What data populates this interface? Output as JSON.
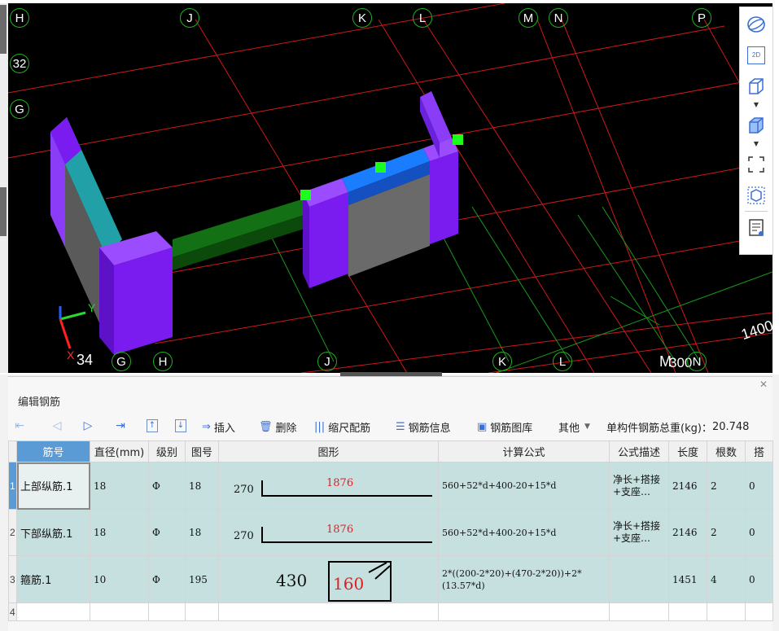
{
  "viewport": {
    "axis_markers_top": [
      "H",
      "J",
      "K",
      "L",
      "M",
      "N",
      "P"
    ],
    "axis_markers_left": [
      "32",
      "G"
    ],
    "axis_markers_bottom": [
      "G",
      "H",
      "J",
      "K",
      "L",
      "N"
    ],
    "bottom_left_label": "34",
    "bottom_m_label": "M",
    "bottom_dim_text": "300",
    "right_dim_text": "1400",
    "gizmo_y_label": "Y",
    "gizmo_x_label": "X",
    "colors": {
      "background": "#000000",
      "grid_red": "#d01818",
      "grid_green": "#1a9a1a",
      "column_purple": "#7a1cf0",
      "beam_green": "#0e5a0e",
      "beam_blue": "#1a6cf0",
      "wall_cyan": "#22a0a8",
      "wall_grey": "#6a6a6a",
      "handle_green": "#1aff1a"
    }
  },
  "right_toolbar": {
    "buttons": [
      "orbit-icon",
      "view-2d-icon",
      "view-3d-cube-icon",
      "view-3d-solid-cube-icon",
      "zoom-extents-icon",
      "component-view-icon",
      "properties-icon"
    ],
    "view_2d_label": "2D"
  },
  "panel": {
    "title": "编辑钢筋",
    "toolbar": {
      "insert": "插入",
      "delete": "删除",
      "scale_rebar": "缩尺配筋",
      "rebar_info": "钢筋信息",
      "rebar_library": "钢筋图库",
      "other": "其他",
      "total_weight_label": "单构件钢筋总重(kg)：",
      "total_weight_value": "20.748"
    },
    "columns": [
      "筋号",
      "直径(mm)",
      "级别",
      "图号",
      "图形",
      "计算公式",
      "公式描述",
      "长度",
      "根数",
      "搭"
    ],
    "rows": [
      {
        "row_num": "1",
        "name": "上部纵筋.1",
        "diameter": "18",
        "grade": "Φ",
        "figure_no": "18",
        "shape_left": "270",
        "shape_top": "1876",
        "formula": "560+52*d+400-20+15*d",
        "desc": "净长+搭接+支座…",
        "length": "2146",
        "count": "2",
        "lap": "0"
      },
      {
        "row_num": "2",
        "name": "下部纵筋.1",
        "diameter": "18",
        "grade": "Φ",
        "figure_no": "18",
        "shape_left": "270",
        "shape_top": "1876",
        "formula": "560+52*d+400-20+15*d",
        "desc": "净长+搭接+支座…",
        "length": "2146",
        "count": "2",
        "lap": "0"
      },
      {
        "row_num": "3",
        "name": "箍筋.1",
        "diameter": "10",
        "grade": "Φ",
        "figure_no": "195",
        "shape_left": "430",
        "shape_top": "160",
        "formula": "2*((200-2*20)+(470-2*20))+2*(13.57*d)",
        "desc": "",
        "length": "1451",
        "count": "4",
        "lap": "0"
      }
    ],
    "empty_row_num": "4"
  }
}
